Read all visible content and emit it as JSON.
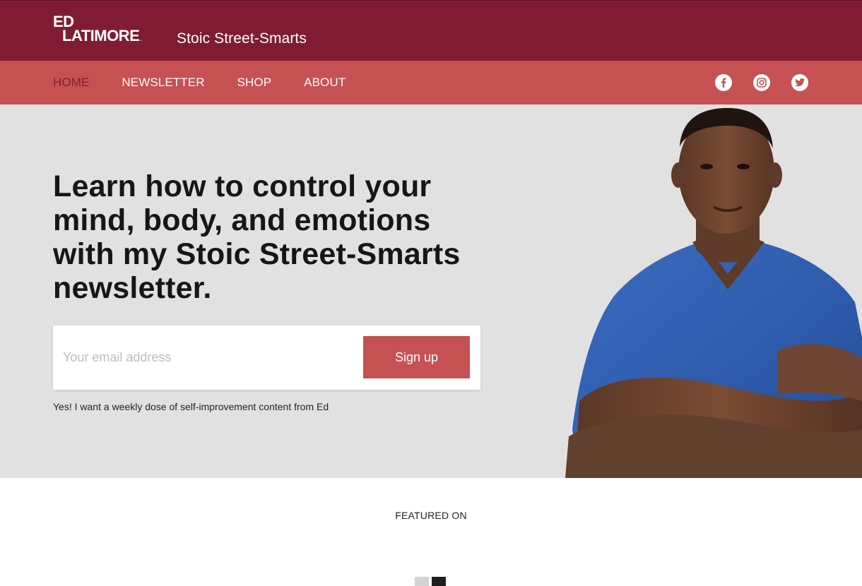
{
  "header": {
    "logo_line1": "ED",
    "logo_line2": "LATIMORE",
    "logo_mark": ".",
    "tagline": "Stoic Street-Smarts"
  },
  "nav": {
    "items": [
      {
        "label": "HOME",
        "active": true
      },
      {
        "label": "NEWSLETTER",
        "active": false
      },
      {
        "label": "SHOP",
        "active": false
      },
      {
        "label": "ABOUT",
        "active": false
      }
    ],
    "social": [
      {
        "icon": "facebook-icon"
      },
      {
        "icon": "instagram-icon"
      },
      {
        "icon": "twitter-icon"
      }
    ]
  },
  "hero": {
    "headline": "Learn how to control your mind, body, and emotions with my Stoic Street-Smarts newsletter.",
    "email_placeholder": "Your email address",
    "signup_label": "Sign up",
    "consent": "Yes! I want a weekly dose of self-improvement content from Ed"
  },
  "featured": {
    "heading": "FEATURED ON"
  },
  "colors": {
    "header_bg": "#7f1c34",
    "nav_bg": "#c65152",
    "hero_bg": "#e2e1e1",
    "button_bg": "#c65152",
    "shirt": "#2f5fb5",
    "skin": "#6b4330"
  }
}
